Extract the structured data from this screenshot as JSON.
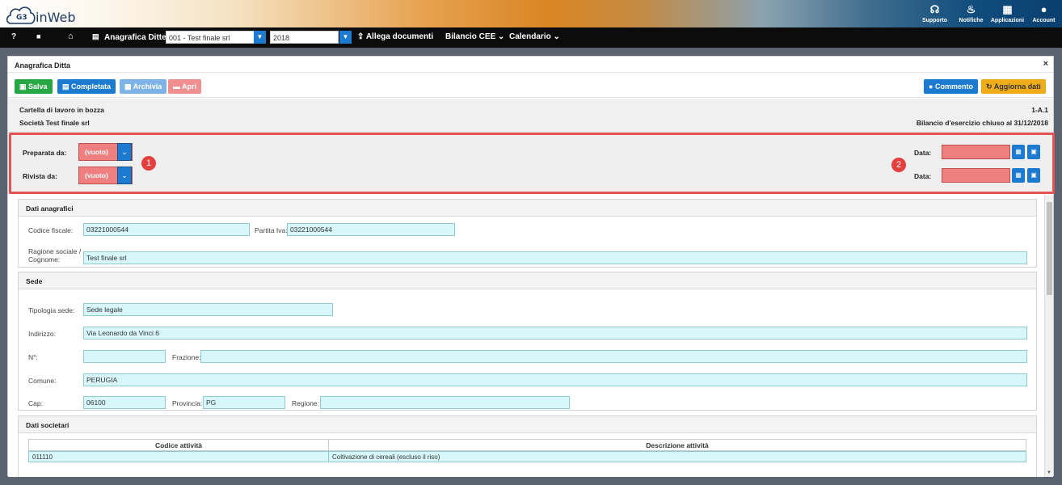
{
  "app": {
    "logo_badge": "G3",
    "logo_text": "inWeb"
  },
  "toolbar": {
    "items": [
      {
        "icon": "headset-icon",
        "glyph": "☊",
        "label": "Supporto"
      },
      {
        "icon": "bell-icon",
        "glyph": "🔔",
        "label": "Notifiche"
      },
      {
        "icon": "grid-icon",
        "glyph": "▦",
        "label": "Applicazioni"
      },
      {
        "icon": "account-icon",
        "glyph": "●",
        "label": "Account"
      }
    ]
  },
  "menubar": {
    "help": "?",
    "section": "Anagrafica Ditte",
    "company_select": "001 - Test finale srl",
    "year_select": "2018",
    "attach": "Allega documenti",
    "bilancio": "Bilancio CEE",
    "calendario": "Calendario"
  },
  "panel": {
    "title": "Anagrafica Ditta",
    "close": "×",
    "buttons": {
      "save": "Salva",
      "completed": "Completata",
      "archive": "Archivia",
      "open": "Apri",
      "comment": "Commento",
      "refresh": "Aggiorna dati"
    },
    "info": {
      "status": "Cartella di lavoro in bozza",
      "company": "Società Test finale srl",
      "code": "1-A.1",
      "fiscal_year": "Bilancio d'esercizio chiuso al 31/12/2018"
    },
    "prep": {
      "prepared_label": "Preparata da:",
      "prepared_value": "(vuoto)",
      "reviewed_label": "Rivista da:",
      "reviewed_value": "(vuoto)",
      "date_label1": "Data:",
      "date_label2": "Data:",
      "badge1": "1",
      "badge2": "2"
    }
  },
  "anagrafici": {
    "title": "Dati anagrafici",
    "cf_label": "Codice fiscale:",
    "cf_value": "03221000544",
    "piva_label": "Partita Iva:",
    "piva_value": "03221000544",
    "ragione_label": "Ragione sociale / Cognome:",
    "ragione_value": "Test finale srl"
  },
  "sede": {
    "title": "Sede",
    "tipologia_label": "Tipologia sede:",
    "tipologia_value": "Sede legale",
    "indirizzo_label": "Indirizzo:",
    "indirizzo_value": "Via Leonardo da Vinci 6",
    "n_label": "N°:",
    "n_value": "",
    "frazione_label": "Frazione:",
    "frazione_value": "",
    "comune_label": "Comune:",
    "comune_value": "PERUGIA",
    "cap_label": "Cap:",
    "cap_value": "06100",
    "provincia_label": "Provincia:",
    "provincia_value": "PG",
    "regione_label": "Regione:",
    "regione_value": ""
  },
  "societari": {
    "title": "Dati societari",
    "col_codice": "Codice attività",
    "col_descr": "Descrizione attività",
    "row_codice": "011110",
    "row_descr": "Coltivazione di cereali (escluso il riso)"
  },
  "colors": {
    "accent": "#1c7ad0",
    "success": "#27a844",
    "warning": "#f0ad1b",
    "empty_field": "#f08080",
    "highlight": "#e55454"
  }
}
